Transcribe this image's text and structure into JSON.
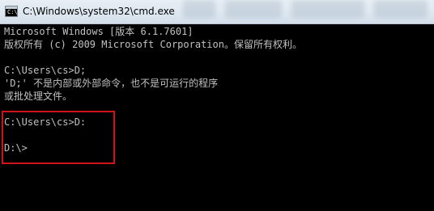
{
  "window": {
    "title": "C:\\Windows\\system32\\cmd.exe",
    "icon": "cmd-icon"
  },
  "console": {
    "lines": [
      "Microsoft Windows [版本 6.1.7601]",
      "版权所有 (c) 2009 Microsoft Corporation。保留所有权利。",
      "",
      "C:\\Users\\cs>D;",
      "'D;' 不是内部或外部命令，也不是可运行的程序",
      "或批处理文件。",
      "",
      "C:\\Users\\cs>D:",
      "",
      "D:\\>"
    ]
  },
  "colors": {
    "console_background": "#000000",
    "console_text": "#c0c0c0",
    "highlight_border": "#d0121b"
  }
}
